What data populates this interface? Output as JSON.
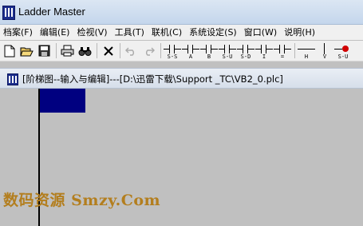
{
  "window": {
    "title": "Ladder Master"
  },
  "menu": [
    "档案(F)",
    "编辑(E)",
    "检视(V)",
    "工具(T)",
    "联机(C)",
    "系统设定(S)",
    "窗口(W)",
    "说明(H)"
  ],
  "toolbar": {
    "icons": [
      "new-file-icon",
      "open-folder-icon",
      "save-icon",
      "print-icon",
      "find-icon",
      "delete-icon",
      "undo-icon",
      "redo-icon"
    ],
    "ladder_buttons": [
      "S-S",
      "A",
      "B",
      "S-U",
      "S-D",
      "I",
      "=",
      "H",
      "V",
      "S-U"
    ]
  },
  "document": {
    "title": "[阶梯图--输入与编辑]---[D:\\迅雷下载\\Support _TC\\VB2_0.plc]"
  },
  "watermark": "数码资源 Smzy.Com",
  "colors": {
    "cursor": "#000080",
    "workarea": "#c0c0c0",
    "watermark": "#b37e1e"
  }
}
